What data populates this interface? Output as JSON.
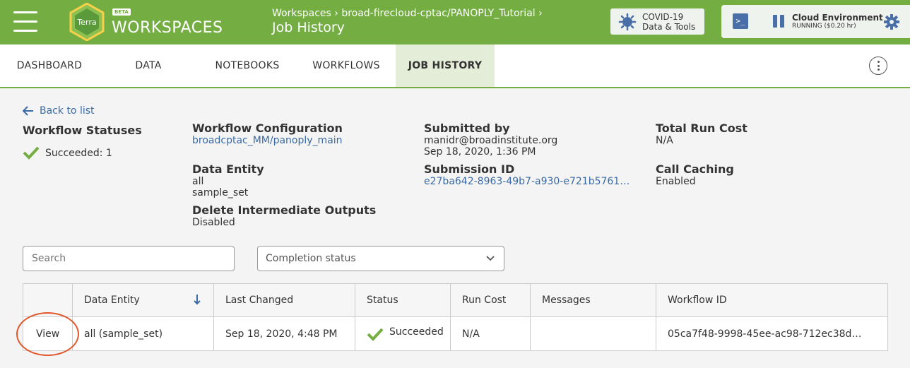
{
  "header": {
    "logo_text": "Terra",
    "beta": "BETA",
    "app_title": "WORKSPACES",
    "breadcrumb": "Workspaces › broad-firecloud-cptac/PANOPLY_Tutorial ›",
    "page_title": "Job History",
    "covid_line1": "COVID-19",
    "covid_line2": "Data & Tools",
    "cloud_title": "Cloud Environment",
    "cloud_status": "RUNNING ($0.20 hr)"
  },
  "tabs": [
    "DASHBOARD",
    "DATA",
    "NOTEBOOKS",
    "WORKFLOWS",
    "JOB HISTORY"
  ],
  "back_label": "Back to list",
  "summary": {
    "statuses_heading": "Workflow Statuses",
    "status_line": "Succeeded: 1",
    "config_heading": "Workflow Configuration",
    "config_value": "broadcptac_MM/panoply_main",
    "entity_heading": "Data Entity",
    "entity_line1": "all",
    "entity_line2": "sample_set",
    "delete_heading": "Delete Intermediate Outputs",
    "delete_value": "Disabled",
    "submitted_heading": "Submitted by",
    "submitted_user": "manidr@broadinstitute.org",
    "submitted_date": "Sep 18, 2020, 1:36 PM",
    "submission_heading": "Submission ID",
    "submission_value": "e27ba642-8963-49b7-a930-e721b5761…",
    "cost_heading": "Total Run Cost",
    "cost_value": "N/A",
    "caching_heading": "Call Caching",
    "caching_value": "Enabled"
  },
  "filters": {
    "search_placeholder": "Search",
    "status_placeholder": "Completion status"
  },
  "table": {
    "headers": [
      "",
      "Data Entity",
      "Last Changed",
      "Status",
      "Run Cost",
      "Messages",
      "Workflow ID"
    ],
    "row": {
      "view": "View",
      "entity": "all (sample_set)",
      "changed": "Sep 18, 2020, 4:48 PM",
      "status": "Succeeded",
      "cost": "N/A",
      "messages": "",
      "workflow_id": "05ca7f48-9998-45ee-ac98-712ec38d…"
    }
  },
  "colors": {
    "brand": "#74ae43",
    "link": "#3a6aa3",
    "highlight": "#e1572c"
  }
}
